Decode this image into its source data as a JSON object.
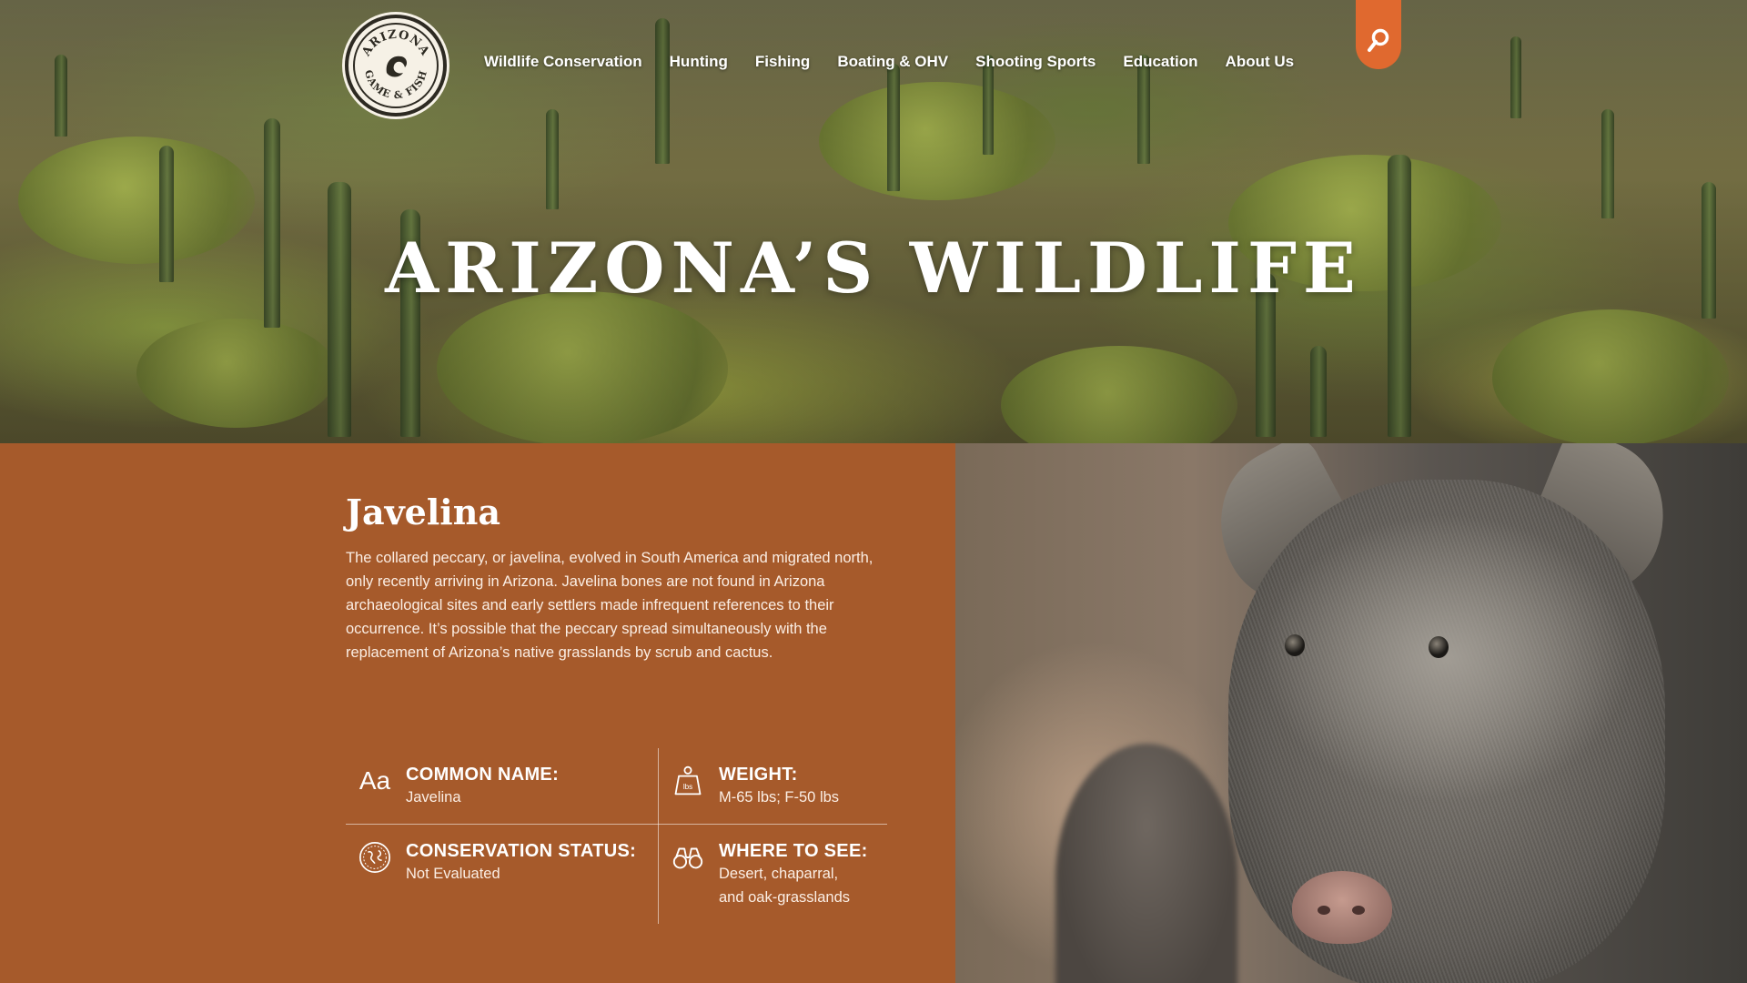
{
  "brand": {
    "logo_alt": "Arizona Game & Fish",
    "logo_text_top": "ARIZONA",
    "logo_text_bottom": "GAME & FISH"
  },
  "nav": {
    "items": [
      {
        "label": "Wildlife Conservation"
      },
      {
        "label": "Hunting"
      },
      {
        "label": "Fishing"
      },
      {
        "label": "Boating & OHV"
      },
      {
        "label": "Shooting Sports"
      },
      {
        "label": "Education"
      },
      {
        "label": "About Us"
      }
    ],
    "search_icon": "search-icon"
  },
  "hero": {
    "title": "ARIZONA’S WILDLIFE"
  },
  "species": {
    "name": "Javelina",
    "description": "The collared peccary, or javelina, evolved in South America and migrated north, only recently arriving in Arizona. Javelina bones are not found in Arizona archaeological sites and early settlers made infrequent references to their occurrence. It’s possible that the peccary spread simultaneously with the replacement of Arizona’s native grasslands by scrub and cactus.",
    "facts": {
      "common_name": {
        "icon": "text-aa-icon",
        "icon_glyph": "Aa",
        "label": "COMMON NAME:",
        "value": "Javelina"
      },
      "weight": {
        "icon": "weight-icon",
        "label": "WEIGHT:",
        "value": "M-65 lbs; F-50 lbs"
      },
      "conservation_status": {
        "icon": "globe-icon",
        "label": "CONSERVATION STATUS:",
        "value": "Not Evaluated"
      },
      "where_to_see": {
        "icon": "binoculars-icon",
        "label": "WHERE TO SEE:",
        "value_line1": "Desert, chaparral,",
        "value_line2": "and oak-grasslands"
      }
    }
  },
  "colors": {
    "panel": "#a65a2b",
    "accent": "#e0692f",
    "text": "#ffffff"
  }
}
